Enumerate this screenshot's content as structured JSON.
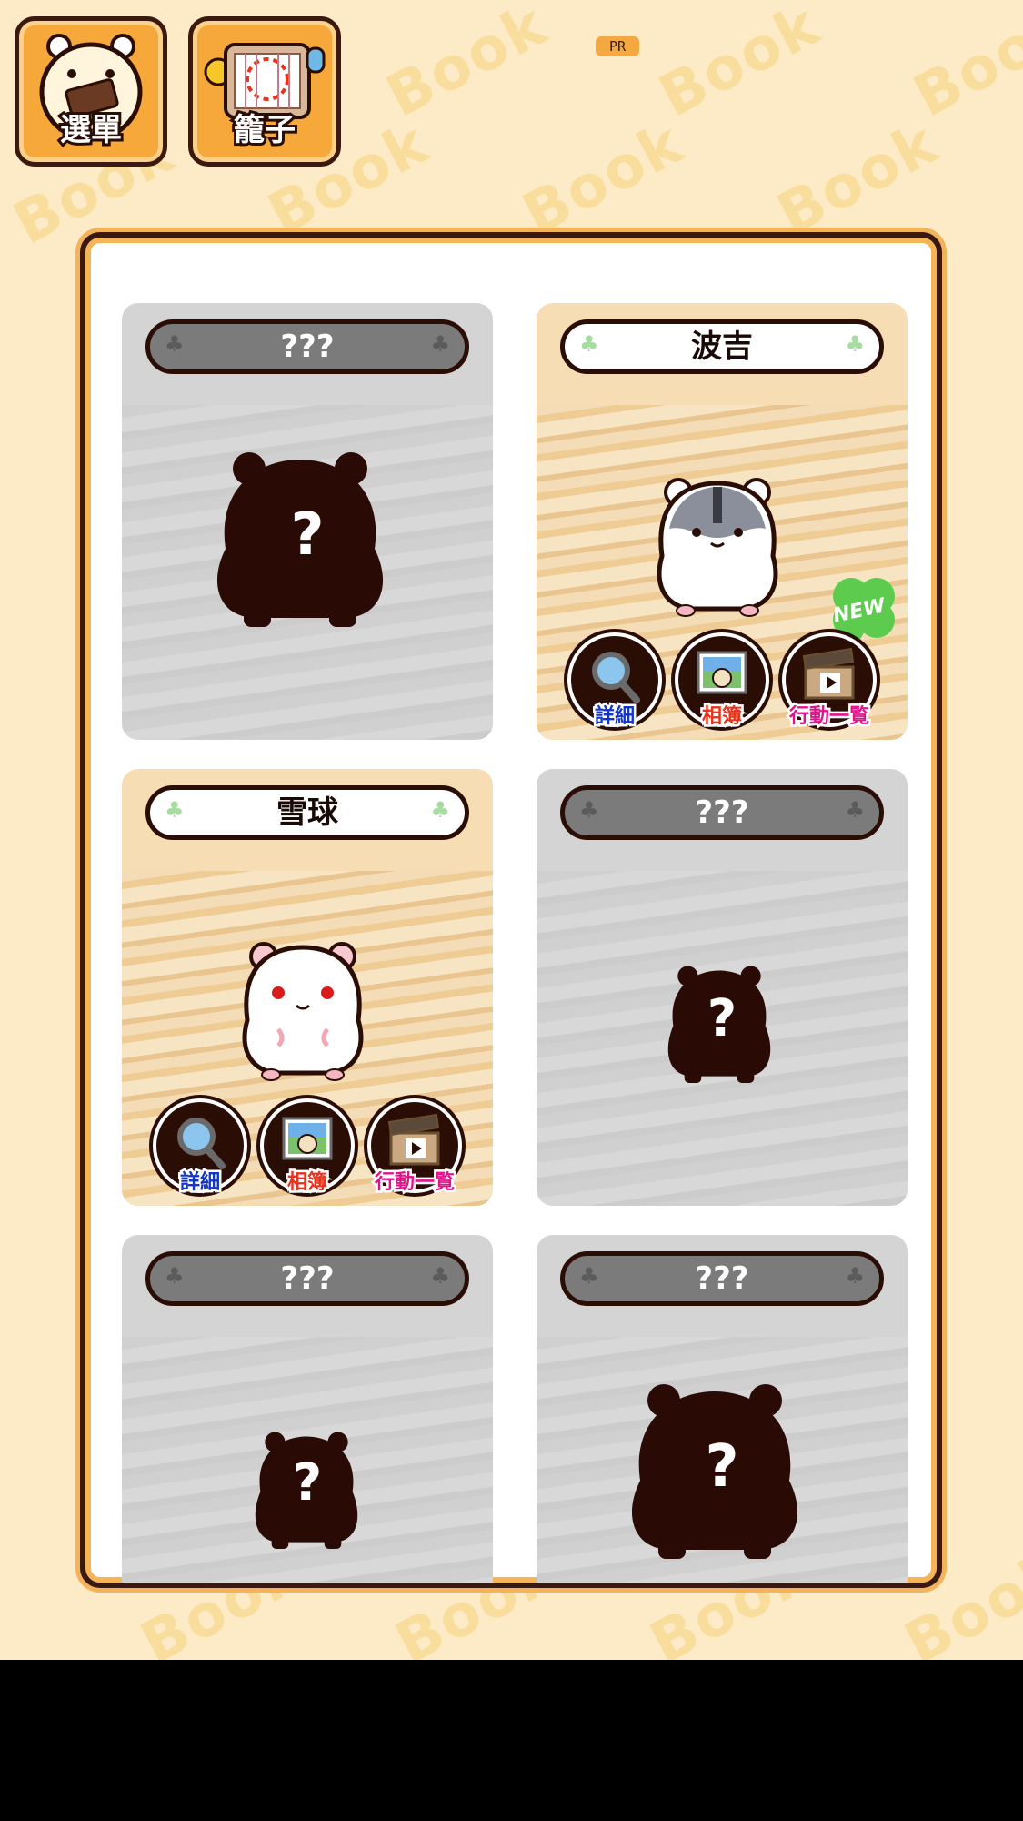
{
  "header": {
    "menu_label": "選單",
    "cage_label": "籠子",
    "pr_label": "PR"
  },
  "watermark_text": "Book",
  "colors": {
    "background": "#fdeac6",
    "frame_border": "#3a1a10",
    "locked_card": "#d4d4d4",
    "unlocked_card": "#f7ddb3",
    "details_label": "#1336c8",
    "album_label": "#e8341c",
    "actions_label": "#e0148a"
  },
  "cards": [
    {
      "name": "???",
      "state": "locked",
      "question": "?"
    },
    {
      "name": "波吉",
      "state": "unlocked",
      "hamster": "grey-white-dwarf-hamster",
      "new_badge": "NEW",
      "buttons": {
        "details": "詳細",
        "album": "相簿",
        "actions": "行動一覧"
      }
    },
    {
      "name": "雪球",
      "state": "unlocked",
      "hamster": "white-red-eyed-hamster",
      "buttons": {
        "details": "詳細",
        "album": "相簿",
        "actions": "行動一覧"
      }
    },
    {
      "name": "???",
      "state": "locked",
      "question": "?"
    },
    {
      "name": "???",
      "state": "locked",
      "question": "?"
    },
    {
      "name": "???",
      "state": "locked",
      "question": "?"
    }
  ]
}
